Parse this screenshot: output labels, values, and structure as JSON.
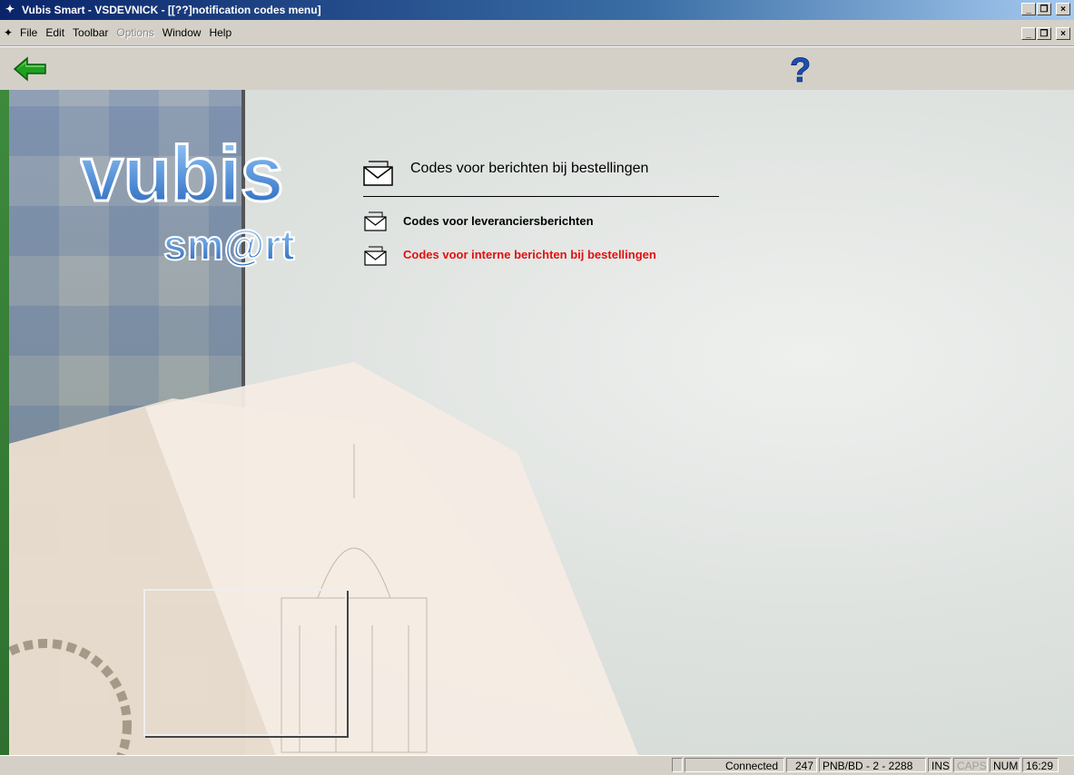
{
  "window": {
    "title": "Vubis Smart - VSDEVNICK - [[??]notification codes menu]",
    "app_icon": "vubis-app-icon"
  },
  "menubar": {
    "items": [
      {
        "label": "File",
        "enabled": true
      },
      {
        "label": "Edit",
        "enabled": true
      },
      {
        "label": "Toolbar",
        "enabled": true
      },
      {
        "label": "Options",
        "enabled": false
      },
      {
        "label": "Window",
        "enabled": true
      },
      {
        "label": "Help",
        "enabled": true
      }
    ]
  },
  "window_controls": {
    "minimize": "_",
    "restore": " ",
    "close": "×"
  },
  "toolbar": {
    "back_icon": "green-left-arrow-icon",
    "help_icon": "question-mark-icon"
  },
  "logo": {
    "line1": "vubis",
    "line2": "sm@rt"
  },
  "menu": {
    "title": "Codes voor berichten bij bestellingen",
    "items": [
      {
        "label": "Codes voor leveranciersberichten",
        "active": false
      },
      {
        "label": "Codes voor interne berichten bij bestellingen",
        "active": true
      }
    ]
  },
  "statusbar": {
    "connection": "Connected",
    "count": "247",
    "context": "PNB/BD - 2 - 2288",
    "ins": "INS",
    "caps": "CAPS",
    "num": "NUM",
    "time": "16:29"
  },
  "colors": {
    "active_item": "#e01010",
    "title_bar_start": "#0a246a",
    "arrow": "#1fa01f"
  }
}
